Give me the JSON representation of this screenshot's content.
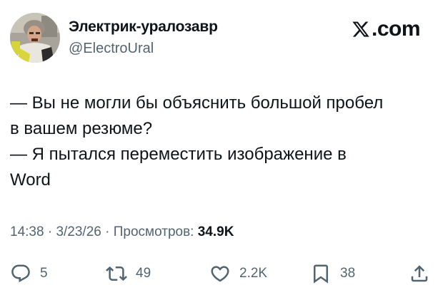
{
  "author": {
    "name": "Электрик-уралозавр",
    "handle": "@ElectroUral",
    "avatar_icon": "profile-photo-avatar"
  },
  "brand": {
    "site": ".com",
    "logo_icon": "x-logo-icon"
  },
  "tweet": {
    "lines": [
      "— Вы не могли бы объяснить большой пробел",
      "в вашем резюме?",
      "— Я пытался переместить изображение в",
      "Word"
    ]
  },
  "meta": {
    "time": "14:38",
    "sep1": " · ",
    "date": "3/23/26",
    "sep2": " · ",
    "views_label": "Просмотров: ",
    "views_count": "34.9K"
  },
  "actions": {
    "reply": {
      "icon": "reply-icon",
      "count": "5"
    },
    "retweet": {
      "icon": "retweet-icon",
      "count": "49"
    },
    "like": {
      "icon": "heart-icon",
      "count": "2.2K"
    },
    "bookmark": {
      "icon": "bookmark-icon",
      "count": "38"
    },
    "share": {
      "icon": "share-icon"
    }
  },
  "colors": {
    "text": "#0f1419",
    "secondary": "#536471",
    "background": "#ffffff"
  }
}
